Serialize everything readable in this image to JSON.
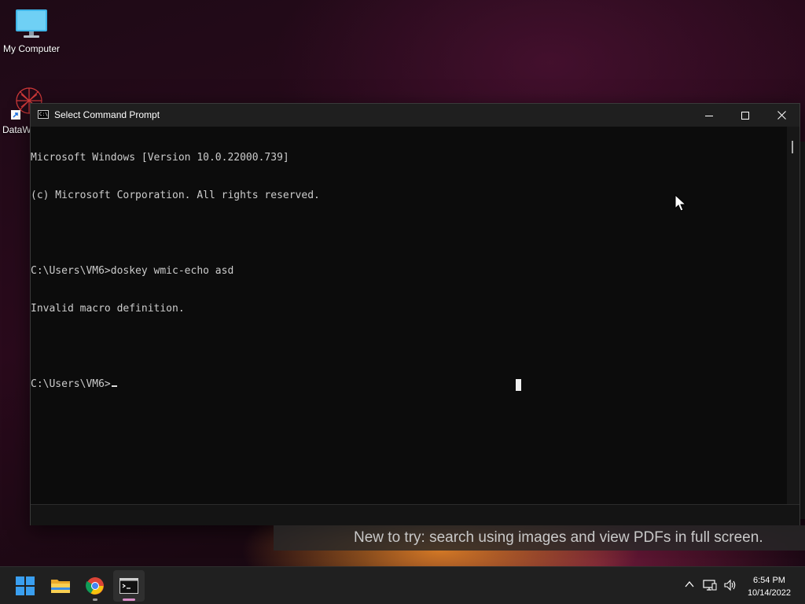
{
  "desktop": {
    "icons": [
      {
        "label": "My Computer"
      },
      {
        "label": "DataW"
      }
    ]
  },
  "window": {
    "title": "Select Command Prompt",
    "icon_name": "cmd-icon",
    "controls": {
      "minimize": "minimize-icon",
      "maximize": "maximize-icon",
      "close": "close-icon"
    }
  },
  "console": {
    "lines": [
      "Microsoft Windows [Version 10.0.22000.739]",
      "(c) Microsoft Corporation. All rights reserved.",
      "",
      "C:\\Users\\VM6>doskey wmic-echo asd",
      "Invalid macro definition.",
      "",
      "C:\\Users\\VM6>"
    ]
  },
  "banner": {
    "text": "New to try: search using images and view PDFs in full screen."
  },
  "taskbar": {
    "apps": [
      {
        "name": "start",
        "icon": "windows-start-icon"
      },
      {
        "name": "file-explorer",
        "icon": "folder-icon"
      },
      {
        "name": "chrome",
        "icon": "chrome-icon"
      },
      {
        "name": "command-prompt",
        "icon": "cmd-icon",
        "active": true
      }
    ],
    "tray": {
      "icons": [
        "chevron-up-icon",
        "network-icon",
        "volume-icon"
      ],
      "time": "6:54 PM",
      "date": "10/14/2022"
    }
  },
  "colors": {
    "console_bg": "#0c0c0c",
    "console_fg": "#cccccc",
    "taskbar_bg": "#202020",
    "accent_blue": "#0078d4"
  }
}
